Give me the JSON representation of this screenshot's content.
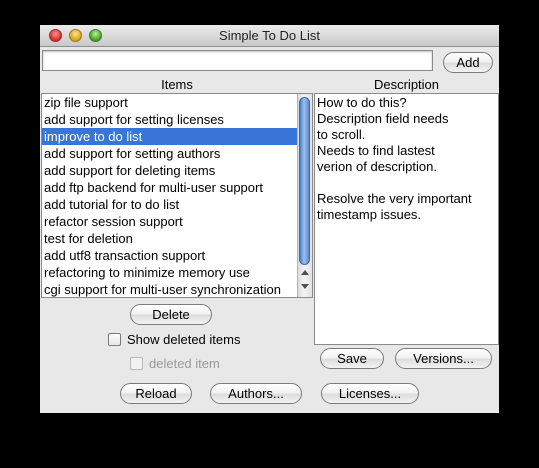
{
  "window": {
    "title": "Simple To Do List"
  },
  "toolbar": {
    "new_item_value": "",
    "add_label": "Add"
  },
  "items_panel": {
    "header": "Items",
    "items": [
      {
        "label": "zip file support",
        "selected": false
      },
      {
        "label": "add support for setting licenses",
        "selected": false
      },
      {
        "label": "improve to do list",
        "selected": true
      },
      {
        "label": "add support for setting authors",
        "selected": false
      },
      {
        "label": "add support for deleting items",
        "selected": false
      },
      {
        "label": "add ftp backend for multi-user support",
        "selected": false
      },
      {
        "label": "add tutorial for to do list",
        "selected": false
      },
      {
        "label": "refactor session support",
        "selected": false
      },
      {
        "label": "test for deletion",
        "selected": false
      },
      {
        "label": "add utf8 transaction support",
        "selected": false
      },
      {
        "label": "refactoring to minimize memory use",
        "selected": false
      },
      {
        "label": "cgi support for multi-user synchronization",
        "selected": false
      }
    ],
    "delete_label": "Delete",
    "show_deleted_label": "Show deleted items",
    "show_deleted_checked": false,
    "deleted_item_label": "deleted item",
    "deleted_item_checked": false
  },
  "description_panel": {
    "header": "Description",
    "text": "How to do this?\nDescription field needs\nto scroll.\nNeeds to find lastest\nverion of description.\n\nResolve the very important\ntimestamp issues.",
    "save_label": "Save",
    "versions_label": "Versions..."
  },
  "bottom_bar": {
    "reload_label": "Reload",
    "authors_label": "Authors...",
    "licenses_label": "Licenses..."
  },
  "colors": {
    "selection": "#3875d7",
    "window_bg": "#e8e8e8",
    "scroll_thumb": "#6f9ad8"
  }
}
